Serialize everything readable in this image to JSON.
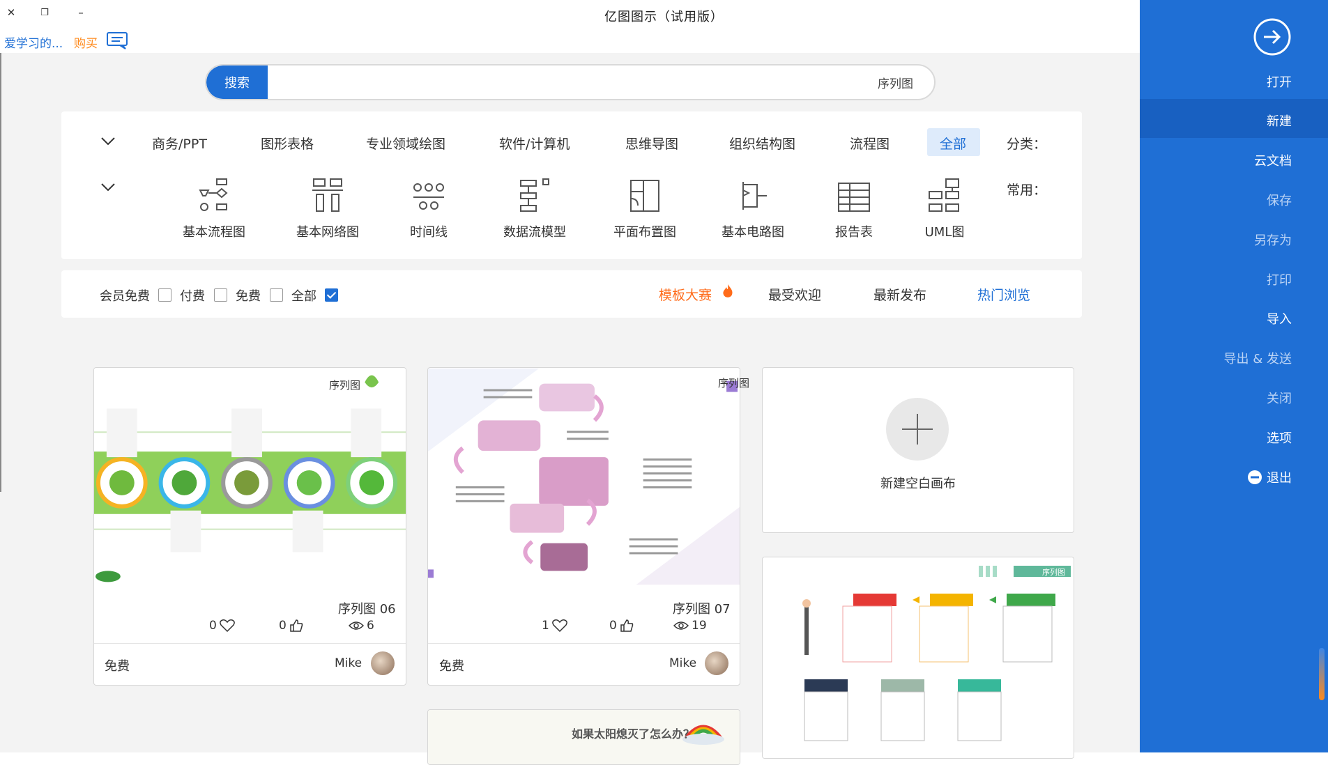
{
  "window": {
    "title": "亿图图示（试用版）",
    "close_glyph": "✕",
    "restore_glyph": "❐",
    "minimize_glyph": "–"
  },
  "menu": {
    "user": "爱学习的...",
    "buy": "购买"
  },
  "sidebar": {
    "items": [
      {
        "label": "打开"
      },
      {
        "label": "新建"
      },
      {
        "label": "云文档"
      },
      {
        "label": "保存"
      },
      {
        "label": "另存为"
      },
      {
        "label": "打印"
      },
      {
        "label": "导入"
      },
      {
        "label": "导出 & 发送"
      },
      {
        "label": "关闭"
      },
      {
        "label": "选项"
      },
      {
        "label": "退出"
      }
    ]
  },
  "search": {
    "button": "搜索",
    "value": "序列图"
  },
  "categories": {
    "label": "分类：",
    "tabs": [
      "全部",
      "流程图",
      "组织结构图",
      "思维导图",
      "软件/计算机",
      "专业领域绘图",
      "图形表格",
      "商务/PPT"
    ],
    "active": "全部"
  },
  "common": {
    "label": "常用：",
    "tools": [
      "UML图",
      "报告表",
      "基本电路图",
      "平面布置图",
      "数据流模型",
      "时间线",
      "基本网络图",
      "基本流程图"
    ]
  },
  "filters": {
    "tabs": [
      "热门浏览",
      "最新发布",
      "最受欢迎",
      "模板大赛"
    ],
    "active": "热门浏览",
    "checkboxes": [
      {
        "label": "全部",
        "checked": true
      },
      {
        "label": "免费",
        "checked": false
      },
      {
        "label": "付费",
        "checked": false
      },
      {
        "label": "会员免费",
        "checked": false
      }
    ]
  },
  "new_canvas": {
    "label": "新建空白画布"
  },
  "cards": [
    {
      "title": "序列图 07",
      "views": "19",
      "likes": "0",
      "favorites": "1",
      "author": "Mike",
      "price": "免费",
      "thumb_title": "序列图"
    },
    {
      "title": "序列图 06",
      "views": "6",
      "likes": "0",
      "favorites": "0",
      "author": "Mike",
      "price": "免费",
      "thumb_title": "序列图"
    }
  ],
  "partial_cards": {
    "right_bottom_title": "序列图",
    "middle_bottom_title": "如果太阳熄灭了怎么办？"
  },
  "colors": {
    "accent": "#1F6FD5",
    "contest": "#ff6b1a"
  }
}
